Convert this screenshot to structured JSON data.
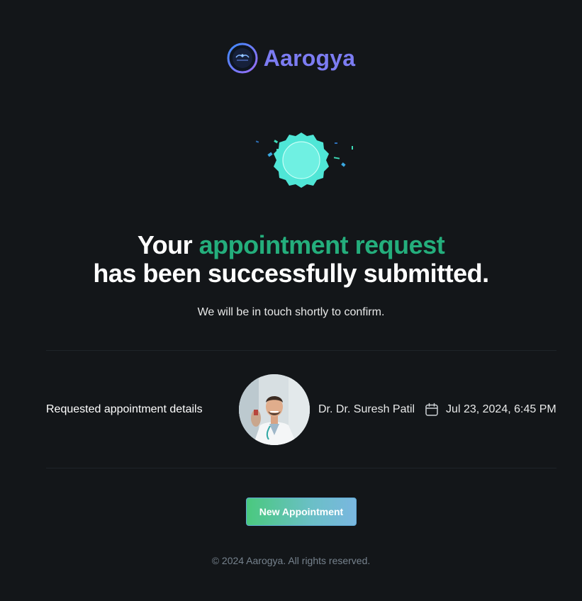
{
  "brand": {
    "name": "Aarogya",
    "color": "#7c7cf2"
  },
  "headline": {
    "prefix": "Your ",
    "accent": "appointment request",
    "suffix": " has been successfully submitted.",
    "accent_color": "#24ae7c"
  },
  "subtext": "We will be in touch shortly to confirm.",
  "details": {
    "label": "Requested appointment details",
    "doctor_name": "Dr. Dr. Suresh Patil",
    "date": "Jul 23, 2024, 6:45 PM"
  },
  "actions": {
    "new_appointment_label": "New Appointment"
  },
  "footer": {
    "copyright": "© 2024 Aarogya. All rights reserved."
  },
  "icons": {
    "logo": "aarogya-logo-icon",
    "success": "success-badge-icon",
    "calendar": "calendar-icon"
  },
  "colors": {
    "background": "#131619",
    "success_badge": "#4fe6d6",
    "button_gradient_start": "#4ac97e",
    "button_gradient_end": "#7ab7e0"
  }
}
